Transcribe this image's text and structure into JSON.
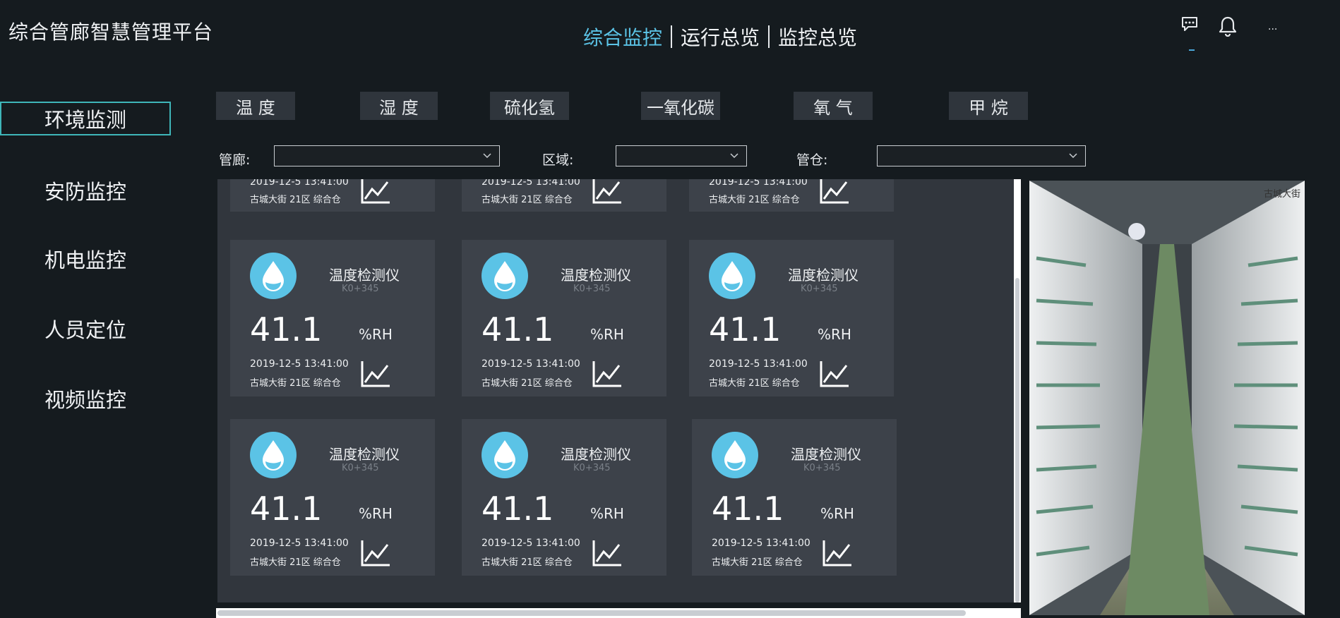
{
  "app": {
    "title": "综合管廊智慧管理平台"
  },
  "top_nav": {
    "items": [
      "综合监控",
      "运行总览",
      "监控总览"
    ],
    "active_index": 0
  },
  "header_icons": [
    "chat-bubble-icon",
    "bell-icon",
    "more-icon"
  ],
  "header_more_text": "...",
  "sidebar": {
    "items": [
      "环境监测",
      "安防监控",
      "机电监控",
      "人员定位",
      "视频监控"
    ],
    "active_index": 0
  },
  "sensor_tabs": [
    "温 度",
    "湿 度",
    "硫化氢",
    "一氧化碳",
    "氧 气",
    "甲 烷"
  ],
  "filters": {
    "corridor": {
      "label": "管廊:",
      "value": ""
    },
    "region": {
      "label": "区域:",
      "value": ""
    },
    "compartment": {
      "label": "管仓:",
      "value": ""
    }
  },
  "cards": {
    "partial_row": [
      {
        "time": "2019-12-5 13:41:00",
        "location": "古城大街 21区 综合仓"
      },
      {
        "time": "2019-12-5 13:41:00",
        "location": "古城大街 21区 综合仓"
      },
      {
        "time": "2019-12-5 13:41:00",
        "location": "古城大街 21区 综合仓"
      }
    ],
    "rows": [
      [
        {
          "title": "温度检测仪",
          "code": "K0+345",
          "value": "41.1",
          "unit": "%RH",
          "time": "2019-12-5 13:41:00",
          "location": "古城大街 21区 综合仓"
        },
        {
          "title": "温度检测仪",
          "code": "K0+345",
          "value": "41.1",
          "unit": "%RH",
          "time": "2019-12-5 13:41:00",
          "location": "古城大街 21区 综合仓"
        },
        {
          "title": "温度检测仪",
          "code": "K0+345",
          "value": "41.1",
          "unit": "%RH",
          "time": "2019-12-5 13:41:00",
          "location": "古城大街 21区 综合仓"
        }
      ],
      [
        {
          "title": "温度检测仪",
          "code": "K0+345",
          "value": "41.1",
          "unit": "%RH",
          "time": "2019-12-5 13:41:00",
          "location": "古城大街 21区 综合仓"
        },
        {
          "title": "温度检测仪",
          "code": "K0+345",
          "value": "41.1",
          "unit": "%RH",
          "time": "2019-12-5 13:41:00",
          "location": "古城大街 21区 综合仓"
        },
        {
          "title": "温度检测仪",
          "code": "K0+345",
          "value": "41.1",
          "unit": "%RH",
          "time": "2019-12-5 13:41:00",
          "location": "古城大街 21区 综合仓"
        }
      ]
    ]
  },
  "video": {
    "caption": "古城大街"
  },
  "colors": {
    "accent": "#5bc3e6",
    "sidebar_active_border": "#3fb6b9",
    "card_bg": "#3d424a",
    "panel_bg": "#31363d",
    "page_bg": "#151b1f"
  }
}
